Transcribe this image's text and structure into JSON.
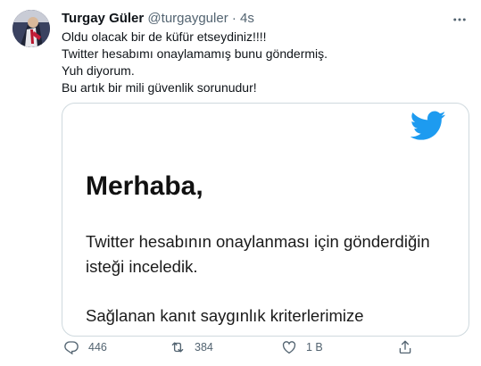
{
  "tweet": {
    "display_name": "Turgay Güler",
    "handle": "@turgayguler",
    "separator": "·",
    "time": "4s",
    "lines": [
      "Oldu olacak bir de küfür etseydiniz!!!!",
      "Twitter hesabımı onaylamamış bunu göndermiş.",
      "Yuh diyorum.",
      "Bu artık bir mili güvenlik sorunudur!"
    ]
  },
  "media": {
    "greeting": "Merhaba,",
    "body_lines": [
      "Twitter hesabının onaylanması için gönderdiğin",
      "isteği inceledik.",
      "Sağlanan kanıt saygınlık kriterlerimize"
    ]
  },
  "actions": {
    "reply_count": "446",
    "retweet_count": "384",
    "like_count": "1 B"
  },
  "icons": {
    "bird": "twitter-bird-icon",
    "more": "more-options-icon",
    "reply": "reply-icon",
    "retweet": "retweet-icon",
    "like": "heart-icon",
    "share": "share-icon"
  },
  "colors": {
    "brand_blue": "#1d9bf0",
    "secondary_text": "#536471"
  }
}
